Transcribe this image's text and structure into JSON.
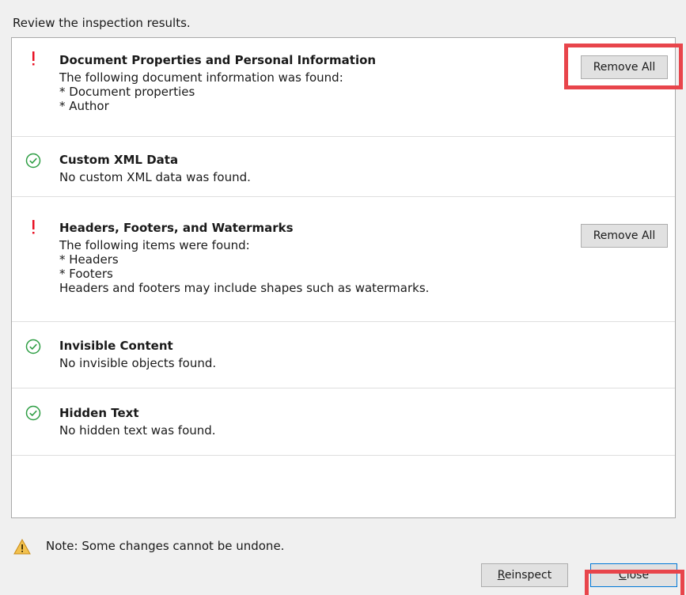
{
  "instruction": "Review the inspection results.",
  "results": [
    {
      "status_icon": "exclamation-icon",
      "title": "Document Properties and Personal Information",
      "lines": [
        "The following document information was found:",
        "* Document properties",
        "* Author"
      ],
      "button_label": "Remove All"
    },
    {
      "status_icon": "check-circle-icon",
      "title": "Custom XML Data",
      "lines": [
        "No custom XML data was found."
      ]
    },
    {
      "status_icon": "exclamation-icon",
      "title": "Headers, Footers, and Watermarks",
      "lines": [
        "The following items were found:",
        "* Headers",
        "* Footers",
        "Headers and footers may include shapes such as watermarks."
      ],
      "button_label": "Remove All"
    },
    {
      "status_icon": "check-circle-icon",
      "title": "Invisible Content",
      "lines": [
        "No invisible objects found."
      ]
    },
    {
      "status_icon": "check-circle-icon",
      "title": "Hidden Text",
      "lines": [
        "No hidden text was found."
      ]
    }
  ],
  "note": {
    "icon": "warning-icon",
    "text": "Note: Some changes cannot be undone."
  },
  "footer": {
    "reinspect": {
      "accel": "R",
      "rest": "einspect"
    },
    "close": {
      "accel": "C",
      "rest": "lose"
    }
  },
  "colors": {
    "warning_red": "#e81123",
    "check_green": "#2e9e44",
    "highlight_red": "#e8454b",
    "warning_yellow": "#f2c14e"
  }
}
